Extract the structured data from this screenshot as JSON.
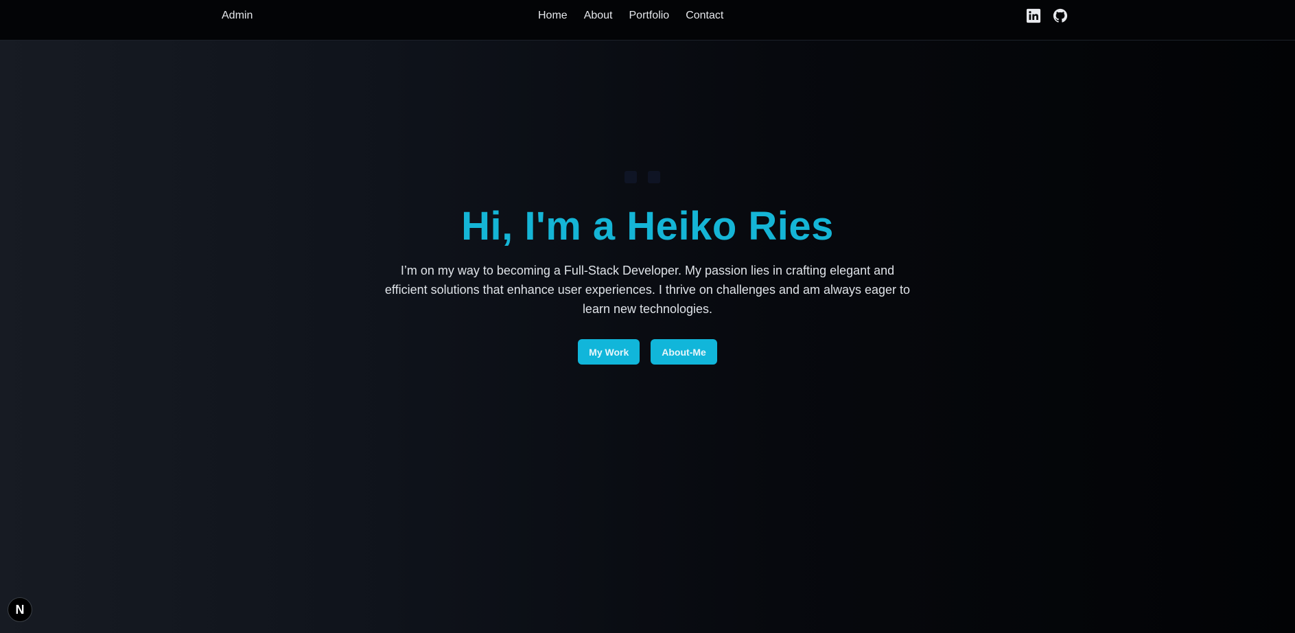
{
  "navbar": {
    "brand": "Admin",
    "links": [
      {
        "label": "Home"
      },
      {
        "label": "About"
      },
      {
        "label": "Portfolio"
      },
      {
        "label": "Contact"
      }
    ],
    "social": [
      {
        "icon": "linkedin-icon"
      },
      {
        "icon": "github-icon"
      }
    ]
  },
  "hero": {
    "title": "Hi, I'm a Heiko Ries",
    "text": "I’m on my way to becoming a Full-Stack Developer. My passion lies in crafting elegant and efficient solutions that enhance user experiences. I thrive on challenges and am always eager to learn new technologies.",
    "buttons": {
      "primary": "My Work",
      "secondary": "About-Me"
    }
  },
  "dev_badge": {
    "label": "N"
  },
  "colors": {
    "accent": "#15b5d6",
    "button": "#11b6da",
    "navbar_bg": "#030406"
  }
}
